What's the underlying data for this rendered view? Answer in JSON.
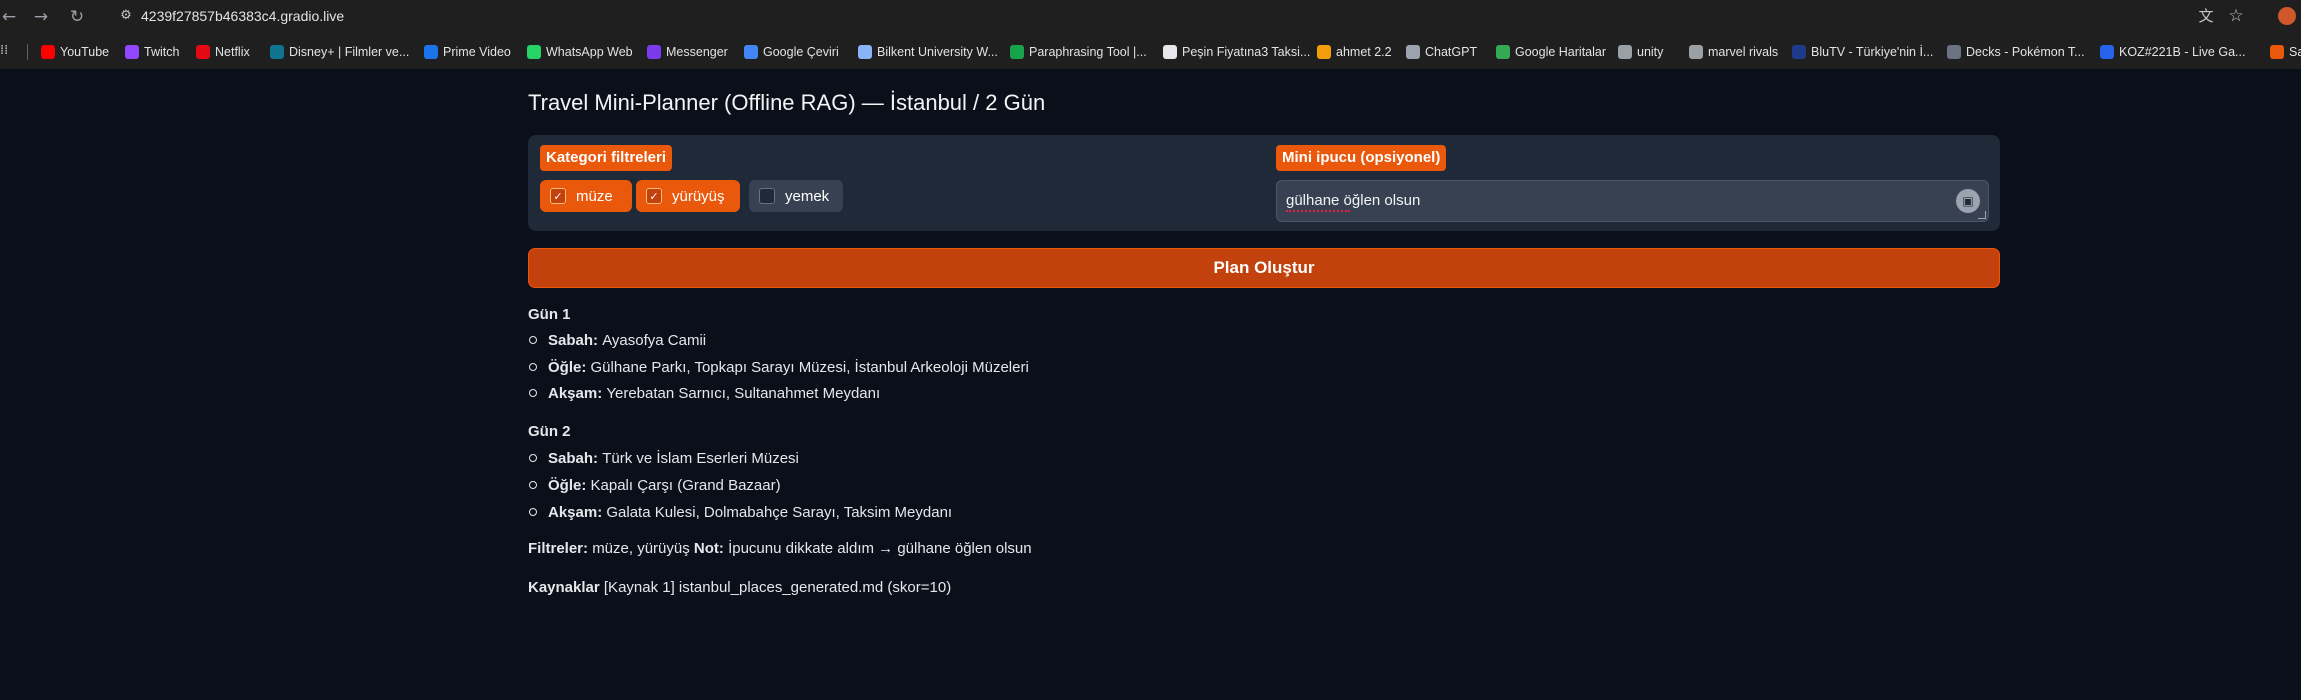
{
  "browser": {
    "url": "4239f27857b46383c4.gradio.live",
    "nav_icons": {
      "back": "back-arrow-icon",
      "forward": "forward-arrow-icon",
      "reload": "reload-icon"
    },
    "bookmarks": [
      {
        "label": "YouTube",
        "icon": "youtube-icon",
        "color": "#ff0000"
      },
      {
        "label": "Twitch",
        "icon": "twitch-icon",
        "color": "#9146ff"
      },
      {
        "label": "Netflix",
        "icon": "netflix-icon",
        "color": "#e50914"
      },
      {
        "label": "Disney+ | Filmler ve...",
        "icon": "disney-icon",
        "color": "#0e7490"
      },
      {
        "label": "Prime Video",
        "icon": "prime-video-icon",
        "color": "#1a73e8"
      },
      {
        "label": "WhatsApp Web",
        "icon": "whatsapp-icon",
        "color": "#25d366"
      },
      {
        "label": "Messenger",
        "icon": "messenger-icon",
        "color": "#7c3aed"
      },
      {
        "label": "Google Çeviri",
        "icon": "google-translate-icon",
        "color": "#4285f4"
      },
      {
        "label": "Bilkent University W...",
        "icon": "bilkent-icon",
        "color": "#8ab4f8"
      },
      {
        "label": "Paraphrasing Tool |...",
        "icon": "paraphrasing-icon",
        "color": "#16a34a"
      },
      {
        "label": "Peşin Fiyatına3 Taksi...",
        "icon": "tag-icon",
        "color": "#e5e7eb"
      },
      {
        "label": "ahmet 2.2",
        "icon": "ahmet-icon",
        "color": "#f59e0b"
      },
      {
        "label": "ChatGPT",
        "icon": "chatgpt-icon",
        "color": "#9ca3af"
      },
      {
        "label": "Google Haritalar",
        "icon": "google-maps-icon",
        "color": "#34a853"
      },
      {
        "label": "unity",
        "icon": "folder-icon",
        "color": "#9aa0a6"
      },
      {
        "label": "marvel rivals",
        "icon": "folder-icon",
        "color": "#9aa0a6"
      },
      {
        "label": "BluTV - Türkiye'nin İ...",
        "icon": "blutv-icon",
        "color": "#1e3a8a"
      },
      {
        "label": "Decks - Pokémon T...",
        "icon": "pokemon-icon",
        "color": "#6b7280"
      },
      {
        "label": "KOZ#221B - Live Ga...",
        "icon": "koz-icon",
        "color": "#2563eb"
      },
      {
        "label": "Sayk",
        "icon": "sayk-icon",
        "color": "#ea580c"
      }
    ]
  },
  "app": {
    "title": "Travel Mini-Planner (Offline RAG) — İstanbul / 2 Gün",
    "filters": {
      "label": "Kategori filtreleri",
      "options": [
        {
          "label": "müze",
          "checked": true
        },
        {
          "label": "yürüyüş",
          "checked": true
        },
        {
          "label": "yemek",
          "checked": false
        }
      ]
    },
    "hint": {
      "label": "Mini ipucu (opsiyonel)",
      "value": "gülhane öğlen olsun"
    },
    "plan_button": "Plan Oluştur",
    "output": {
      "days": [
        {
          "title": "Gün 1",
          "items": [
            {
              "label": "Sabah:",
              "text": "Ayasofya Camii"
            },
            {
              "label": "Öğle:",
              "text": "Gülhane Parkı, Topkapı Sarayı Müzesi, İstanbul Arkeoloji Müzeleri"
            },
            {
              "label": "Akşam:",
              "text": "Yerebatan Sarnıcı, Sultanahmet Meydanı"
            }
          ]
        },
        {
          "title": "Gün 2",
          "items": [
            {
              "label": "Sabah:",
              "text": "Türk ve İslam Eserleri Müzesi"
            },
            {
              "label": "Öğle:",
              "text": "Kapalı Çarşı (Grand Bazaar)"
            },
            {
              "label": "Akşam:",
              "text": "Galata Kulesi, Dolmabahçe Sarayı, Taksim Meydanı"
            }
          ]
        }
      ],
      "filters_label": "Filtreler:",
      "filters_value": "müze, yürüyüş",
      "note_label": "Not:",
      "note_value": "İpucunu dikkate aldım → gülhane öğlen olsun",
      "sources_label": "Kaynaklar",
      "sources_value": "[Kaynak 1] istanbul_places_generated.md (skor=10)"
    }
  }
}
